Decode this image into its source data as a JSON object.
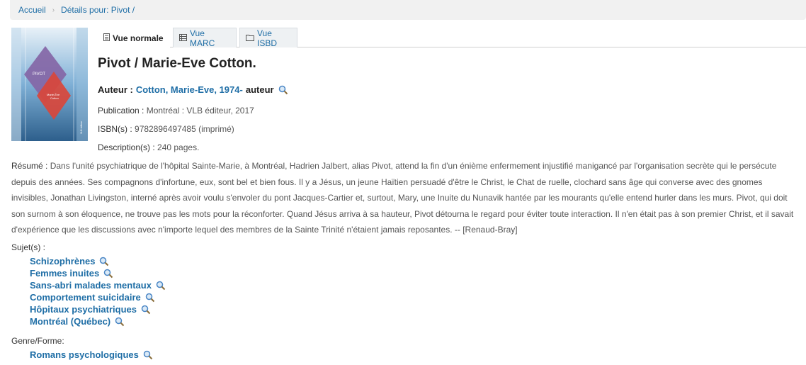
{
  "breadcrumb": {
    "home": "Accueil",
    "current": "Détails pour: Pivot /"
  },
  "cover": {
    "title": "PIVOT",
    "author_line1": "Marie-Ève",
    "author_line2": "Cotton",
    "publisher": "VLB éditeur"
  },
  "tabs": [
    {
      "label": "Vue normale",
      "active": true
    },
    {
      "label": "Vue MARC",
      "active": false
    },
    {
      "label": "Vue ISBD",
      "active": false
    }
  ],
  "record": {
    "title": "Pivot / Marie-Eve Cotton.",
    "author_label": "Auteur :",
    "author_name": "Cotton, Marie-Eve, 1974-",
    "author_role": "auteur",
    "publication_label": "Publication :",
    "publication_value": "Montréal : VLB éditeur, 2017",
    "isbn_label": "ISBN(s) :",
    "isbn_value": "9782896497485 (imprimé)",
    "description_label": "Description(s) :",
    "description_value": "240 pages."
  },
  "resume": {
    "label": "Résumé :",
    "text": "Dans l'unité psychiatrique de l'hôpital Sainte-Marie, à Montréal, Hadrien Jalbert, alias Pivot, attend la fin d'un énième enfermement injustifié manigancé par l'organisation secrète qui le persécute depuis des années. Ses compagnons d'infortune, eux, sont bel et bien fous. Il y a Jésus, un jeune Haïtien persuadé d'être le Christ, le Chat de ruelle, clochard sans âge qui converse avec des gnomes invisibles, Jonathan Livingston, interné après avoir voulu s'envoler du pont Jacques-Cartier et, surtout, Mary, une Inuite du Nunavik hantée par les mourants qu'elle entend hurler dans les murs. Pivot, qui doit son surnom à son éloquence, ne trouve pas les mots pour la réconforter. Quand Jésus arriva à sa hauteur, Pivot détourna le regard pour éviter toute interaction. Il n'en était pas à son premier Christ, et il savait d'expérience que les discussions avec n'importe lequel des membres de la Sainte Trinité n'étaient jamais reposantes. -- [Renaud-Bray]"
  },
  "subjects": {
    "label": "Sujet(s) :",
    "items": [
      "Schizophrènes",
      "Femmes inuites",
      "Sans-abri malades mentaux",
      "Comportement suicidaire",
      "Hôpitaux psychiatriques",
      "Montréal (Québec)"
    ]
  },
  "genre": {
    "label": "Genre/Forme:",
    "items": [
      "Romans psychologiques"
    ]
  },
  "colors": {
    "link": "#1f6ea6",
    "breadcrumb_bg": "#f1f1f1"
  }
}
